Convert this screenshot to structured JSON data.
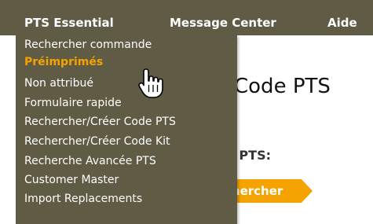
{
  "nav": {
    "items": [
      {
        "label": "PTS Essential"
      },
      {
        "label": "Message Center"
      },
      {
        "label": "Aide"
      }
    ]
  },
  "page": {
    "title": "Code PTS",
    "search_label": "e PTS:",
    "search_button": "chercher"
  },
  "dropdown": {
    "items": [
      {
        "label": "Rechercher commande"
      },
      {
        "label": "Préimprimés"
      },
      {
        "label": "Non attribué"
      },
      {
        "label": "Formulaire rapide"
      },
      {
        "label": "Rechercher/Créer Code PTS"
      },
      {
        "label": "Rechercher/Créer Code Kit"
      },
      {
        "label": "Recherche Avancée PTS"
      },
      {
        "label": "Customer Master"
      },
      {
        "label": "Import Replacements"
      }
    ],
    "active_index": 1
  },
  "colors": {
    "nav_bg": "#5f5b45",
    "accent": "#f5a300",
    "menu_text": "#ffffff"
  },
  "icons": {
    "cursor": "hand-pointer-icon"
  }
}
